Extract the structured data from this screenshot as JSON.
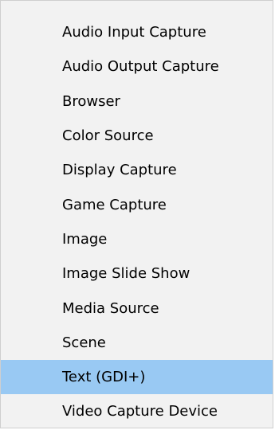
{
  "menu": {
    "items": [
      {
        "label": "Audio Input Capture"
      },
      {
        "label": "Audio Output Capture"
      },
      {
        "label": "Browser"
      },
      {
        "label": "Color Source"
      },
      {
        "label": "Display Capture"
      },
      {
        "label": "Game Capture"
      },
      {
        "label": "Image"
      },
      {
        "label": "Image Slide Show"
      },
      {
        "label": "Media Source"
      },
      {
        "label": "Scene"
      },
      {
        "label": "Text (GDI+)",
        "selected": true
      },
      {
        "label": "Video Capture Device"
      }
    ],
    "selected_item": "Text (GDI+)",
    "colors": {
      "background": "#f2f2f2",
      "highlight": "#99c9f3",
      "text": "#000000"
    }
  }
}
